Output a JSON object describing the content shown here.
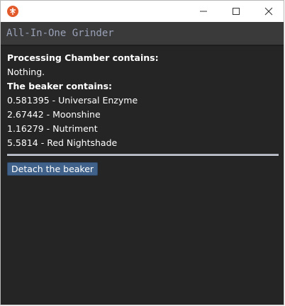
{
  "window": {
    "icon": "grinder-app-icon",
    "controls": {
      "minimize_icon": "minimize-icon",
      "maximize_icon": "maximize-icon",
      "close_icon": "close-icon"
    }
  },
  "header": {
    "title": "All-In-One Grinder"
  },
  "processing_chamber": {
    "heading": "Processing Chamber contains:",
    "contents": "Nothing."
  },
  "beaker": {
    "heading": "The beaker contains:",
    "reagents": [
      "0.581395 - Universal Enzyme",
      "2.67442 - Moonshine",
      "1.16279 - Nutriment",
      "5.5814 - Red Nightshade"
    ]
  },
  "actions": {
    "detach_label": "Detach the beaker"
  },
  "colors": {
    "header_bg": "#3a3a3a",
    "content_bg": "#252525",
    "button_bg": "#40628a",
    "title_text": "#9aa2b8"
  }
}
